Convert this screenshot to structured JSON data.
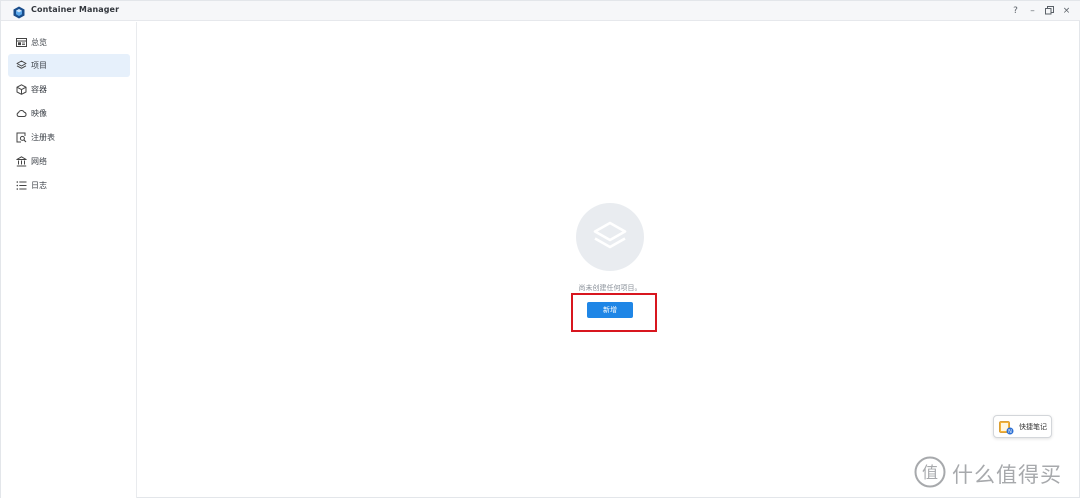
{
  "window": {
    "title": "Container Manager",
    "controls": {
      "help": "?",
      "minimize": "–",
      "restore": "restore-icon",
      "close": "×"
    }
  },
  "sidebar": {
    "items": [
      {
        "label": "总览",
        "icon": "overview-icon",
        "active": false
      },
      {
        "label": "项目",
        "icon": "layers-icon",
        "active": true
      },
      {
        "label": "容器",
        "icon": "cube-icon",
        "active": false
      },
      {
        "label": "映像",
        "icon": "cloud-icon",
        "active": false
      },
      {
        "label": "注册表",
        "icon": "registry-search-icon",
        "active": false
      },
      {
        "label": "网络",
        "icon": "network-icon",
        "active": false
      },
      {
        "label": "日志",
        "icon": "list-icon",
        "active": false
      }
    ]
  },
  "main": {
    "empty_icon": "layers-icon",
    "empty_message": "尚未创建任何项目。",
    "add_button_label": "新增"
  },
  "quick_note": {
    "label": "快捷笔记",
    "icon": "note-icon"
  },
  "watermark": {
    "text": "什么值得买",
    "logo": "zhi-logo"
  },
  "colors": {
    "accent": "#1f86e6",
    "active_nav_bg": "#e6f0fb",
    "highlight_border": "#d8161f",
    "empty_circle": "#e9ecf0"
  }
}
